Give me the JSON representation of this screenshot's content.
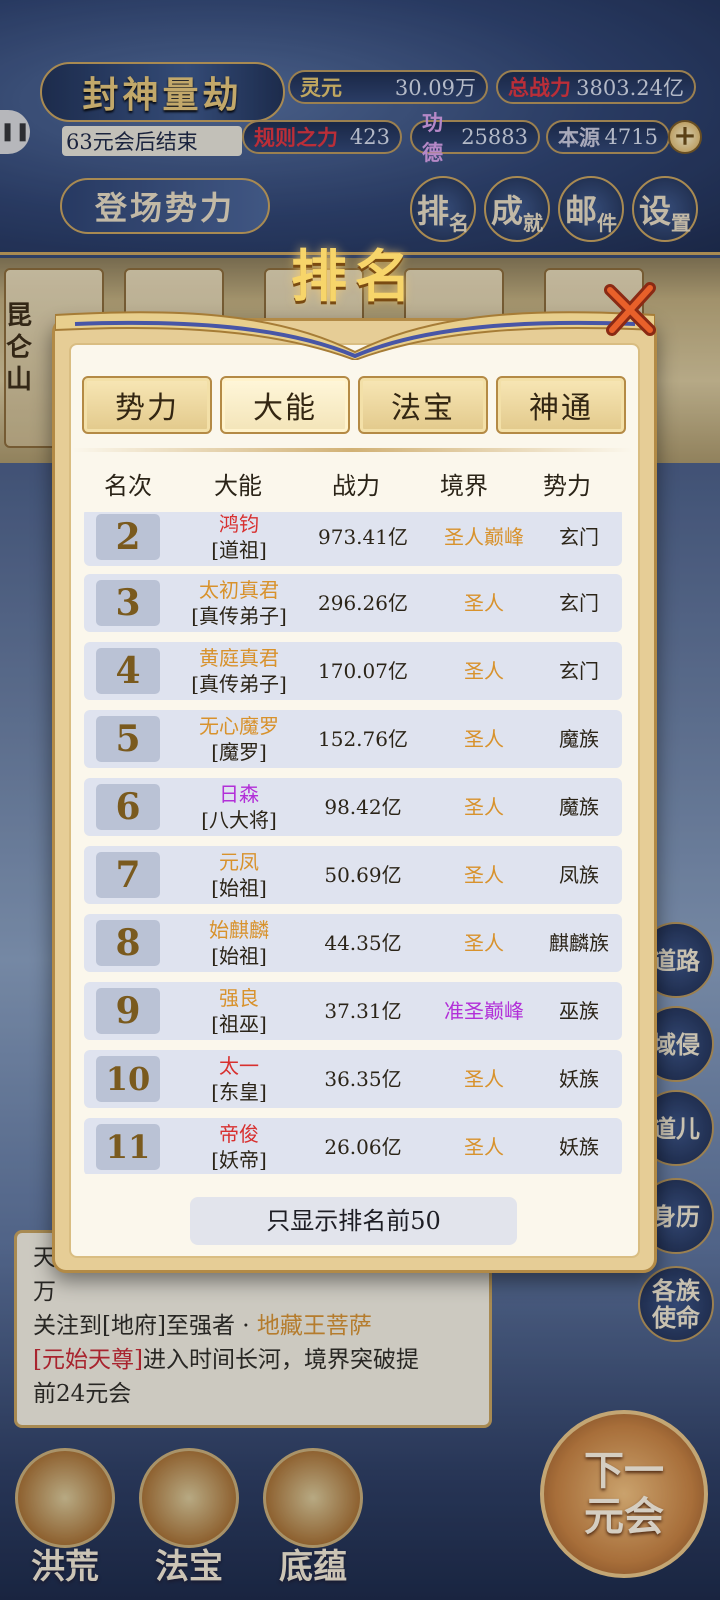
{
  "header": {
    "title": "封神量劫",
    "end_text": "63元会后结束",
    "faction_button": "登场势力",
    "resources": [
      {
        "label": "灵元",
        "value": "30.09万",
        "color": "#e6c66b"
      },
      {
        "label": "总战力",
        "value": "3803.24亿",
        "color": "#e0333a"
      },
      {
        "label": "规则之力",
        "value": "423",
        "color": "#e0333a"
      },
      {
        "label": "功德",
        "value": "25883",
        "color": "#d8a0e8"
      },
      {
        "label": "本源",
        "value": "4715",
        "color": "#c8c8d8"
      }
    ],
    "plus": "+",
    "menu": [
      {
        "label": "排",
        "sub": "名"
      },
      {
        "label": "成",
        "sub": "就"
      },
      {
        "label": "邮",
        "sub": "件"
      },
      {
        "label": "设",
        "sub": "置"
      }
    ]
  },
  "map": {
    "location": "昆仑山"
  },
  "right_menu": [
    "道路",
    "域侵",
    "道儿",
    "身历",
    "各族使命"
  ],
  "log": {
    "line1": "天",
    "line1_tail": "万",
    "line2_pre": "关注到[地府]至强者 · ",
    "line2_name": "地藏王菩萨",
    "line3_name": "[元始天尊]",
    "line3_rest": "进入时间长河，境界突破提",
    "line4": "前24元会"
  },
  "bottom_nav": [
    "洪荒",
    "法宝",
    "底蕴"
  ],
  "next_button": "下一元会",
  "modal": {
    "title": "排名",
    "tabs": [
      "势力",
      "大能",
      "法宝",
      "神通"
    ],
    "active_tab": "大能",
    "columns": [
      "名次",
      "大能",
      "战力",
      "境界",
      "势力"
    ],
    "rows": [
      {
        "rank": "2",
        "name": "鸿钧",
        "title": "[道祖]",
        "power": "973.41亿",
        "realm": "圣人巅峰",
        "faction": "玄门",
        "name_color": "#d8302f",
        "realm_color": "#d8922c"
      },
      {
        "rank": "3",
        "name": "太初真君",
        "title": "[真传弟子]",
        "power": "296.26亿",
        "realm": "圣人",
        "faction": "玄门",
        "name_color": "#d8922c",
        "realm_color": "#d8922c"
      },
      {
        "rank": "4",
        "name": "黄庭真君",
        "title": "[真传弟子]",
        "power": "170.07亿",
        "realm": "圣人",
        "faction": "玄门",
        "name_color": "#d8922c",
        "realm_color": "#d8922c"
      },
      {
        "rank": "5",
        "name": "无心魔罗",
        "title": "[魔罗]",
        "power": "152.76亿",
        "realm": "圣人",
        "faction": "魔族",
        "name_color": "#d8922c",
        "realm_color": "#d8922c"
      },
      {
        "rank": "6",
        "name": "日森",
        "title": "[八大将]",
        "power": "98.42亿",
        "realm": "圣人",
        "faction": "魔族",
        "name_color": "#b22fd8",
        "realm_color": "#d8922c"
      },
      {
        "rank": "7",
        "name": "元凤",
        "title": "[始祖]",
        "power": "50.69亿",
        "realm": "圣人",
        "faction": "凤族",
        "name_color": "#d8922c",
        "realm_color": "#d8922c"
      },
      {
        "rank": "8",
        "name": "始麒麟",
        "title": "[始祖]",
        "power": "44.35亿",
        "realm": "圣人",
        "faction": "麒麟族",
        "name_color": "#d8922c",
        "realm_color": "#d8922c"
      },
      {
        "rank": "9",
        "name": "强良",
        "title": "[祖巫]",
        "power": "37.31亿",
        "realm": "准圣巅峰",
        "faction": "巫族",
        "name_color": "#d8922c",
        "realm_color": "#b22fd8"
      },
      {
        "rank": "10",
        "name": "太一",
        "title": "[东皇]",
        "power": "36.35亿",
        "realm": "圣人",
        "faction": "妖族",
        "name_color": "#d8302f",
        "realm_color": "#d8922c"
      },
      {
        "rank": "11",
        "name": "帝俊",
        "title": "[妖帝]",
        "power": "26.06亿",
        "realm": "圣人",
        "faction": "妖族",
        "name_color": "#d8302f",
        "realm_color": "#d8922c"
      }
    ],
    "footer_button": "只显示排名前50"
  }
}
